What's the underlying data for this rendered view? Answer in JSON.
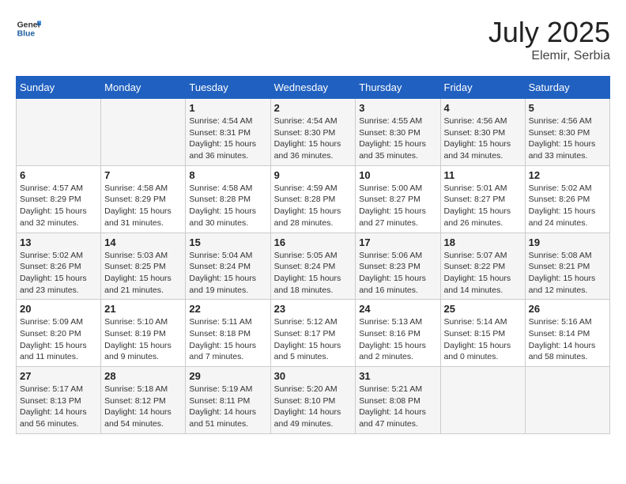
{
  "header": {
    "logo_general": "General",
    "logo_blue": "Blue",
    "month_year": "July 2025",
    "location": "Elemir, Serbia"
  },
  "days_of_week": [
    "Sunday",
    "Monday",
    "Tuesday",
    "Wednesday",
    "Thursday",
    "Friday",
    "Saturday"
  ],
  "weeks": [
    [
      {
        "day": "",
        "info": ""
      },
      {
        "day": "",
        "info": ""
      },
      {
        "day": "1",
        "info": "Sunrise: 4:54 AM\nSunset: 8:31 PM\nDaylight: 15 hours and 36 minutes."
      },
      {
        "day": "2",
        "info": "Sunrise: 4:54 AM\nSunset: 8:30 PM\nDaylight: 15 hours and 36 minutes."
      },
      {
        "day": "3",
        "info": "Sunrise: 4:55 AM\nSunset: 8:30 PM\nDaylight: 15 hours and 35 minutes."
      },
      {
        "day": "4",
        "info": "Sunrise: 4:56 AM\nSunset: 8:30 PM\nDaylight: 15 hours and 34 minutes."
      },
      {
        "day": "5",
        "info": "Sunrise: 4:56 AM\nSunset: 8:30 PM\nDaylight: 15 hours and 33 minutes."
      }
    ],
    [
      {
        "day": "6",
        "info": "Sunrise: 4:57 AM\nSunset: 8:29 PM\nDaylight: 15 hours and 32 minutes."
      },
      {
        "day": "7",
        "info": "Sunrise: 4:58 AM\nSunset: 8:29 PM\nDaylight: 15 hours and 31 minutes."
      },
      {
        "day": "8",
        "info": "Sunrise: 4:58 AM\nSunset: 8:28 PM\nDaylight: 15 hours and 30 minutes."
      },
      {
        "day": "9",
        "info": "Sunrise: 4:59 AM\nSunset: 8:28 PM\nDaylight: 15 hours and 28 minutes."
      },
      {
        "day": "10",
        "info": "Sunrise: 5:00 AM\nSunset: 8:27 PM\nDaylight: 15 hours and 27 minutes."
      },
      {
        "day": "11",
        "info": "Sunrise: 5:01 AM\nSunset: 8:27 PM\nDaylight: 15 hours and 26 minutes."
      },
      {
        "day": "12",
        "info": "Sunrise: 5:02 AM\nSunset: 8:26 PM\nDaylight: 15 hours and 24 minutes."
      }
    ],
    [
      {
        "day": "13",
        "info": "Sunrise: 5:02 AM\nSunset: 8:26 PM\nDaylight: 15 hours and 23 minutes."
      },
      {
        "day": "14",
        "info": "Sunrise: 5:03 AM\nSunset: 8:25 PM\nDaylight: 15 hours and 21 minutes."
      },
      {
        "day": "15",
        "info": "Sunrise: 5:04 AM\nSunset: 8:24 PM\nDaylight: 15 hours and 19 minutes."
      },
      {
        "day": "16",
        "info": "Sunrise: 5:05 AM\nSunset: 8:24 PM\nDaylight: 15 hours and 18 minutes."
      },
      {
        "day": "17",
        "info": "Sunrise: 5:06 AM\nSunset: 8:23 PM\nDaylight: 15 hours and 16 minutes."
      },
      {
        "day": "18",
        "info": "Sunrise: 5:07 AM\nSunset: 8:22 PM\nDaylight: 15 hours and 14 minutes."
      },
      {
        "day": "19",
        "info": "Sunrise: 5:08 AM\nSunset: 8:21 PM\nDaylight: 15 hours and 12 minutes."
      }
    ],
    [
      {
        "day": "20",
        "info": "Sunrise: 5:09 AM\nSunset: 8:20 PM\nDaylight: 15 hours and 11 minutes."
      },
      {
        "day": "21",
        "info": "Sunrise: 5:10 AM\nSunset: 8:19 PM\nDaylight: 15 hours and 9 minutes."
      },
      {
        "day": "22",
        "info": "Sunrise: 5:11 AM\nSunset: 8:18 PM\nDaylight: 15 hours and 7 minutes."
      },
      {
        "day": "23",
        "info": "Sunrise: 5:12 AM\nSunset: 8:17 PM\nDaylight: 15 hours and 5 minutes."
      },
      {
        "day": "24",
        "info": "Sunrise: 5:13 AM\nSunset: 8:16 PM\nDaylight: 15 hours and 2 minutes."
      },
      {
        "day": "25",
        "info": "Sunrise: 5:14 AM\nSunset: 8:15 PM\nDaylight: 15 hours and 0 minutes."
      },
      {
        "day": "26",
        "info": "Sunrise: 5:16 AM\nSunset: 8:14 PM\nDaylight: 14 hours and 58 minutes."
      }
    ],
    [
      {
        "day": "27",
        "info": "Sunrise: 5:17 AM\nSunset: 8:13 PM\nDaylight: 14 hours and 56 minutes."
      },
      {
        "day": "28",
        "info": "Sunrise: 5:18 AM\nSunset: 8:12 PM\nDaylight: 14 hours and 54 minutes."
      },
      {
        "day": "29",
        "info": "Sunrise: 5:19 AM\nSunset: 8:11 PM\nDaylight: 14 hours and 51 minutes."
      },
      {
        "day": "30",
        "info": "Sunrise: 5:20 AM\nSunset: 8:10 PM\nDaylight: 14 hours and 49 minutes."
      },
      {
        "day": "31",
        "info": "Sunrise: 5:21 AM\nSunset: 8:08 PM\nDaylight: 14 hours and 47 minutes."
      },
      {
        "day": "",
        "info": ""
      },
      {
        "day": "",
        "info": ""
      }
    ]
  ]
}
